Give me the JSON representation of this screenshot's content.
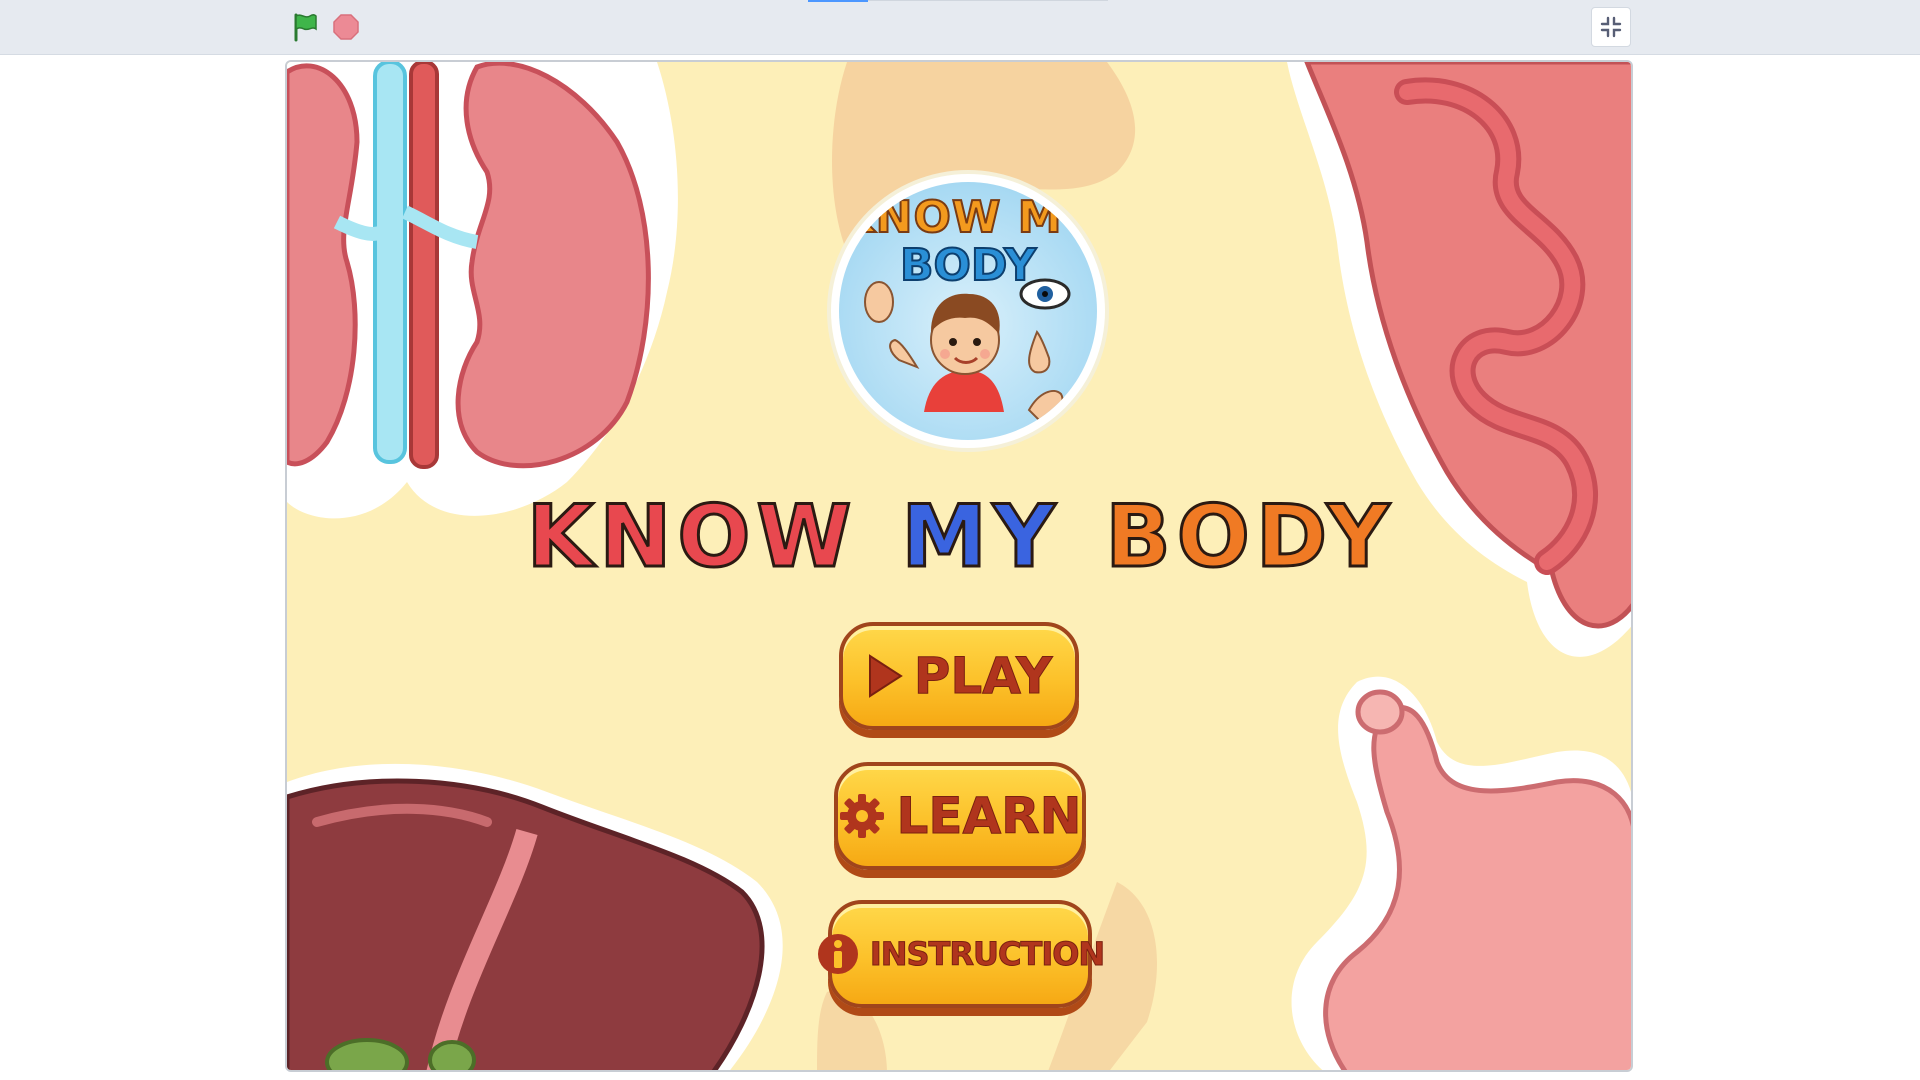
{
  "toolbar": {
    "green_flag_icon": "green-flag-icon",
    "stop_icon": "stop-sign-icon",
    "fullscreen_icon": "exit-fullscreen-icon"
  },
  "game": {
    "logo": {
      "line1": "KNOW MY",
      "line2": "BODY"
    },
    "title": {
      "words": [
        "KNOW",
        "MY",
        "BODY"
      ],
      "colors": [
        "#e8484f",
        "#3a64e0",
        "#f07a24"
      ]
    },
    "menu": {
      "play_label": "PLAY",
      "learn_label": "LEARN",
      "instruction_label": "INSTRUCTION"
    }
  },
  "colors": {
    "stage_background": "#fdefb8",
    "button_fill": "#fcc12a",
    "button_text": "#b0351d",
    "flag_green": "#2ea043",
    "stop_red": "#e57f8a"
  }
}
